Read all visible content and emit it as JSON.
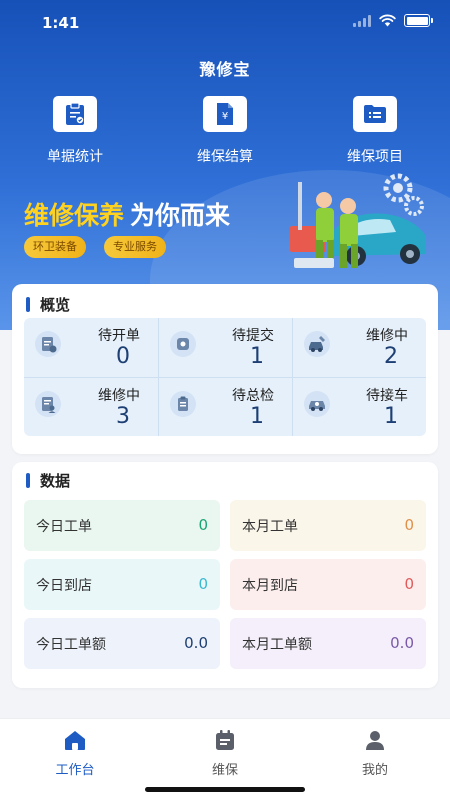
{
  "status": {
    "time": "1:41"
  },
  "app_title": "豫修宝",
  "quick_actions": [
    {
      "label": "单据统计",
      "icon": "clipboard-chart-icon"
    },
    {
      "label": "维保结算",
      "icon": "yuan-document-icon"
    },
    {
      "label": "维保项目",
      "icon": "folder-list-icon"
    }
  ],
  "banner": {
    "headline_yellow": "维修保养",
    "headline_white": "为你而来",
    "tags": [
      "环卫装备",
      "专业服务"
    ]
  },
  "overview": {
    "title": "概览",
    "items": [
      {
        "label": "待开单",
        "value": "0",
        "icon": "invoice-icon"
      },
      {
        "label": "待提交",
        "value": "1",
        "icon": "submit-icon"
      },
      {
        "label": "维修中",
        "value": "2",
        "icon": "car-repair-icon"
      },
      {
        "label": "维修中",
        "value": "3",
        "icon": "document-user-icon"
      },
      {
        "label": "待总检",
        "value": "1",
        "icon": "checklist-icon"
      },
      {
        "label": "待接车",
        "value": "1",
        "icon": "car-pickup-icon"
      }
    ]
  },
  "data_section": {
    "title": "数据",
    "items": [
      {
        "label": "今日工单",
        "value": "0",
        "bg": "#e9f7f0",
        "color": "#1aa577"
      },
      {
        "label": "本月工单",
        "value": "0",
        "bg": "#fbf6ea",
        "color": "#e0904a"
      },
      {
        "label": "今日到店",
        "value": "0",
        "bg": "#eaf7f9",
        "color": "#3bbad0"
      },
      {
        "label": "本月到店",
        "value": "0",
        "bg": "#fdeeee",
        "color": "#e05a5a"
      },
      {
        "label": "今日工单额",
        "value": "0.0",
        "bg": "#eef3fb",
        "color": "#1d3f73"
      },
      {
        "label": "本月工单额",
        "value": "0.0",
        "bg": "#f4effa",
        "color": "#7a5aa8"
      }
    ]
  },
  "tabbar": {
    "tabs": [
      {
        "label": "工作台",
        "icon": "home-icon"
      },
      {
        "label": "维保",
        "icon": "calendar-icon"
      },
      {
        "label": "我的",
        "icon": "person-icon"
      }
    ]
  },
  "colors": {
    "primary": "#1e5cc4",
    "tab_active": "#1e5cc4",
    "tab_inactive": "#555555"
  }
}
